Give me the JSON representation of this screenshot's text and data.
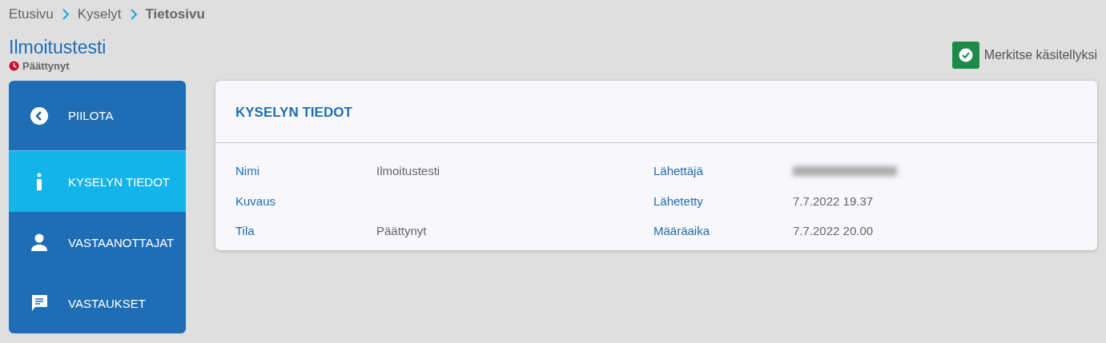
{
  "breadcrumb": [
    {
      "label": "Etusivu",
      "current": false
    },
    {
      "label": "Kyselyt",
      "current": false
    },
    {
      "label": "Tietosivu",
      "current": true
    }
  ],
  "title": "Ilmoitustesti",
  "status": "Päättynyt",
  "mark_button": "Merkitse käsitellyksi",
  "sidebar": {
    "items": [
      {
        "label": "PIILOTA",
        "kind": "back",
        "selected": false
      },
      {
        "label": "KYSELYN TIEDOT",
        "kind": "info",
        "selected": true
      },
      {
        "label": "VASTAANOTTAJAT",
        "kind": "person",
        "selected": false
      },
      {
        "label": "VASTAUKSET",
        "kind": "message",
        "selected": false
      }
    ]
  },
  "card": {
    "title": "KYSELYN TIEDOT",
    "fields": [
      {
        "label": "Nimi",
        "value": "Ilmoitustesti"
      },
      {
        "label": "Lähettäjä",
        "redacted": true
      },
      {
        "label": "Kuvaus"
      },
      {
        "label": "Lähetetty",
        "value": "7.7.2022 19.37"
      },
      {
        "label": "Tila",
        "value": "Päättynyt"
      },
      {
        "label": "Määräaika",
        "value": "7.7.2022 20.00"
      }
    ]
  }
}
